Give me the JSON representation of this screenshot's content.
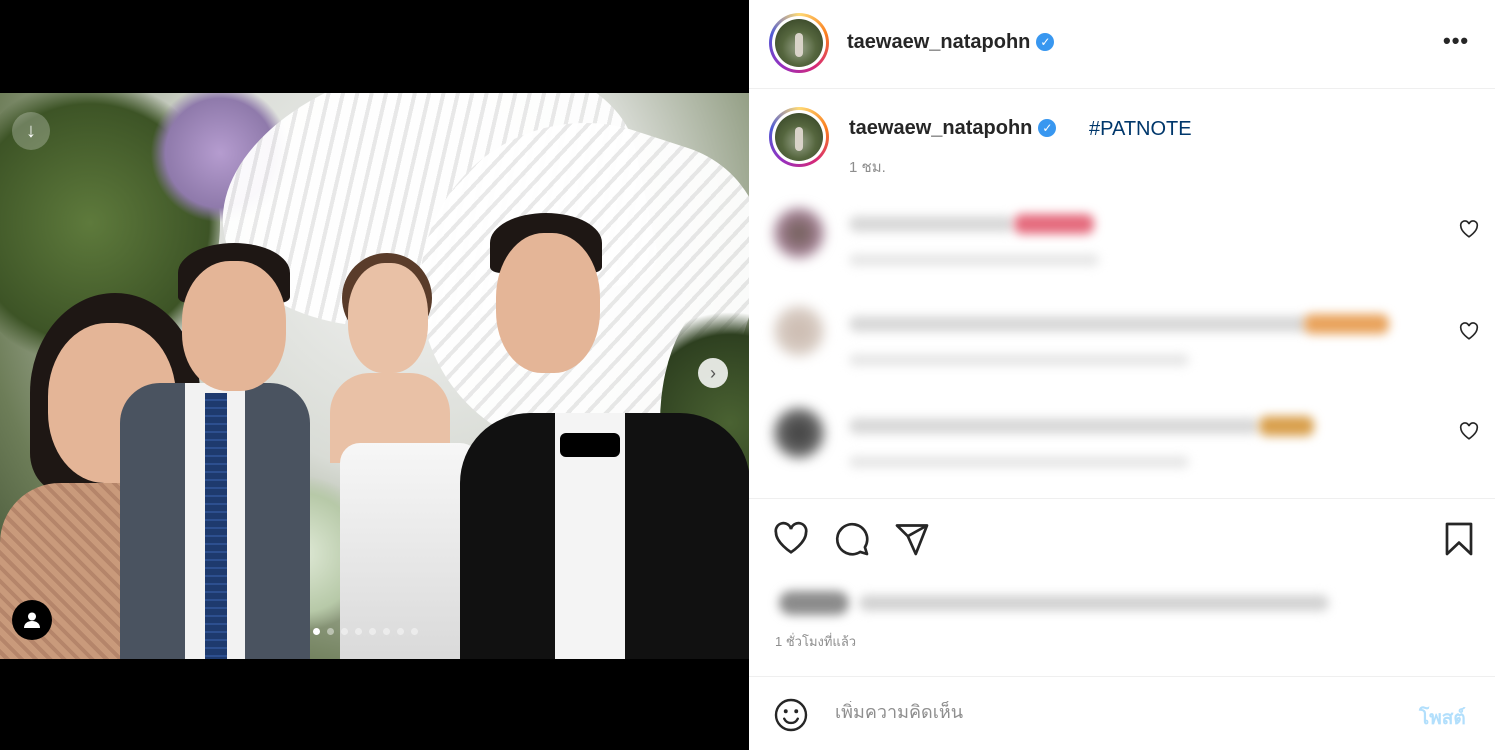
{
  "post": {
    "username": "taewaew_natapohn",
    "verified": true,
    "more_label": "•••",
    "caption": {
      "username": "taewaew_natapohn",
      "hashtag": "#PATNOTE",
      "time": "1 ชม."
    },
    "carousel": {
      "total_slides": 8,
      "active_index": 0
    },
    "post_time": "1 ชั่วโมงที่แล้ว"
  },
  "comments": [
    {
      "hidden": true
    },
    {
      "hidden": true
    },
    {
      "hidden": true
    }
  ],
  "add_comment": {
    "placeholder": "เพิ่มความคิดเห็น",
    "post_label": "โพสต์"
  },
  "icons": {
    "heart": "heart-icon",
    "comment": "comment-icon",
    "share": "share-icon",
    "save": "bookmark-icon",
    "emoji": "emoji-icon",
    "next": "chevron-right-icon",
    "tag": "user-tag-icon",
    "more": "more-icon"
  },
  "colors": {
    "verified": "#3897f0",
    "hashtag": "#00376b",
    "post_disabled": "#b2dffc",
    "secondary_text": "#8e8e8e",
    "border": "#efefef"
  }
}
